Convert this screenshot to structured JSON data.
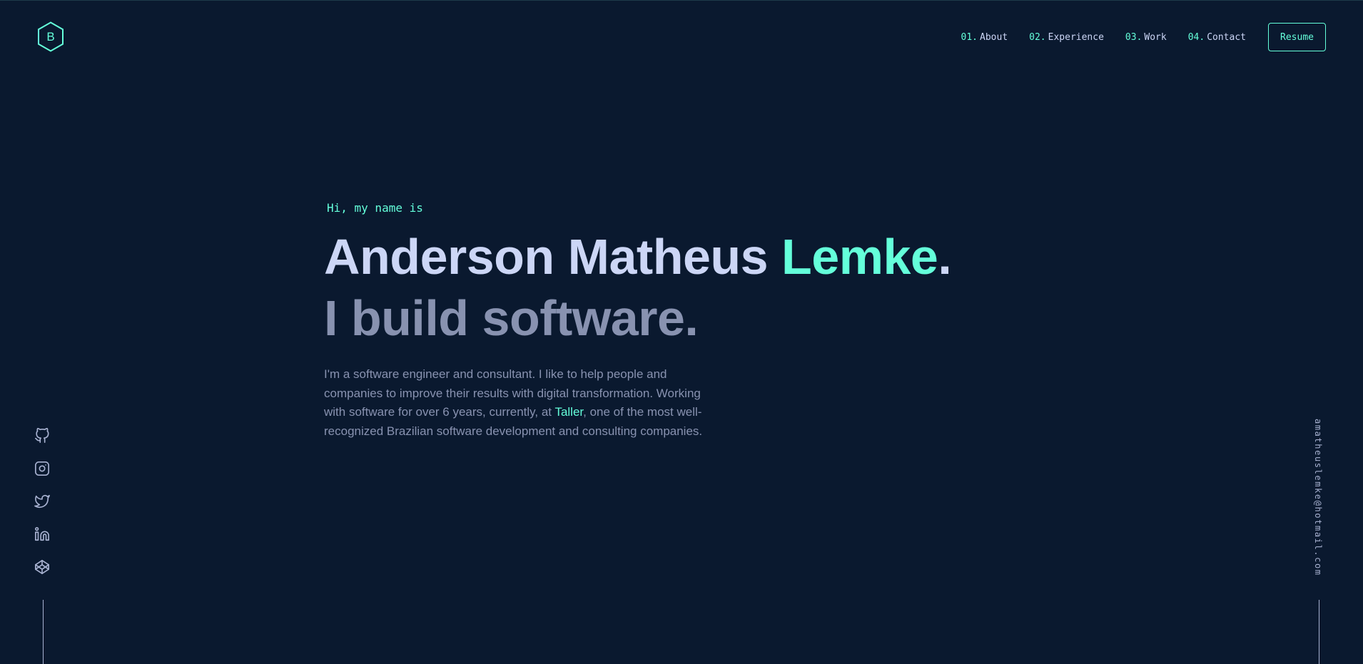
{
  "logo": {
    "letter": "B",
    "icon": "hexagon-logo-icon"
  },
  "nav": {
    "items": [
      {
        "num": "01.",
        "label": "About"
      },
      {
        "num": "02.",
        "label": "Experience"
      },
      {
        "num": "03.",
        "label": "Work"
      },
      {
        "num": "04.",
        "label": "Contact"
      }
    ],
    "resume_label": "Resume"
  },
  "hero": {
    "intro": "Hi, my name is",
    "name_main": "Anderson Matheus ",
    "name_accent": "Lemke",
    "name_period": ".",
    "tagline": "I build software.",
    "bio_before": "I'm a software engineer and consultant. I like to help people and companies to improve their results with digital transformation. Working with software for over 6 years, currently, at ",
    "bio_link": "Taller",
    "bio_after": ", one of the most well-recognized Brazilian software development and consulting companies."
  },
  "social": {
    "icons": [
      "github-icon",
      "instagram-icon",
      "twitter-icon",
      "linkedin-icon",
      "codepen-icon"
    ]
  },
  "email": "amatheuslemke@hotmail.com",
  "colors": {
    "background": "#0a192f",
    "accent": "#64ffda",
    "heading": "#ccd6f6",
    "muted": "#8892b0",
    "icon": "#a8b2d1"
  }
}
